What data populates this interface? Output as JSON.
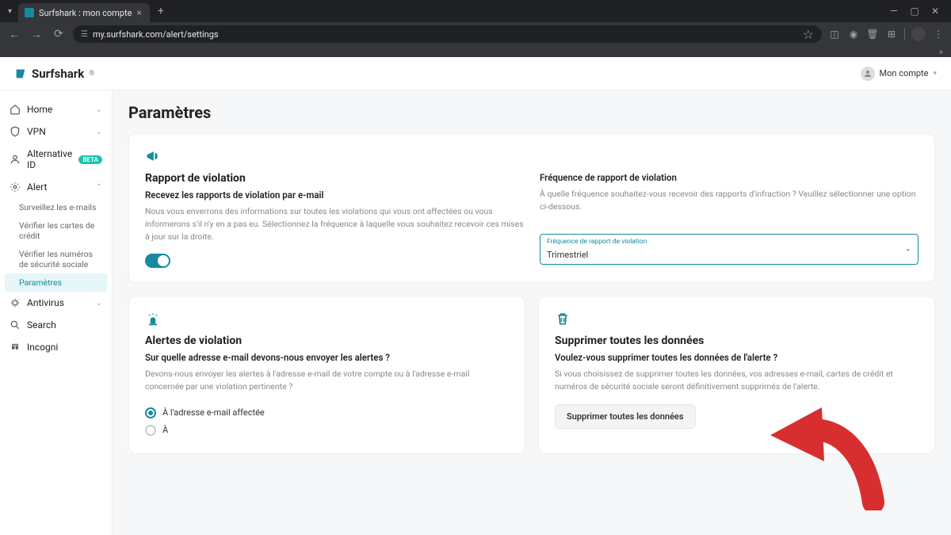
{
  "browser": {
    "tab_title": "Surfshark : mon compte",
    "url": "my.surfshark.com/alert/settings",
    "new_tab": "+",
    "close": "×",
    "star": "☆",
    "win_min": "—",
    "win_max": "▢",
    "win_close": "✕",
    "chevrons": "»"
  },
  "header": {
    "brand": "Surfshark",
    "account_label": "Mon compte"
  },
  "sidebar": {
    "items": [
      {
        "label": "Home",
        "expandable": true
      },
      {
        "label": "VPN",
        "expandable": true
      },
      {
        "label": "Alternative ID",
        "badge": "BETA"
      },
      {
        "label": "Alert",
        "expandable": true,
        "expanded": true
      },
      {
        "label": "Antivirus",
        "expandable": true
      },
      {
        "label": "Search"
      },
      {
        "label": "Incogni"
      }
    ],
    "alert_sub": [
      {
        "label": "Surveillez les e-mails"
      },
      {
        "label": "Vérifier les cartes de crédit"
      },
      {
        "label": "Vérifier les numéros de sécurité sociale"
      },
      {
        "label": "Paramètres",
        "active": true
      }
    ]
  },
  "page": {
    "title": "Paramètres"
  },
  "report": {
    "title": "Rapport de violation",
    "sub": "Recevez les rapports de violation par e-mail",
    "desc": "Nous vous enverrons des informations sur toutes les violations qui vous ont affectées ou vous informerons s'il n'y en a pas eu. Sélectionnez la fréquence à laquelle vous souhaitez recevoir ces mises à jour sur la droite.",
    "freq_title": "Fréquence de rapport de violation",
    "freq_desc": "À quelle fréquence souhaitez-vous recevoir des rapports d'infraction ? Veuillez sélectionner une option ci-dessous.",
    "select_label": "Fréquence de rapport de violation",
    "select_value": "Trimestriel"
  },
  "alerts": {
    "title": "Alertes de violation",
    "sub": "Sur quelle adresse e-mail devons-nous envoyer les alertes ?",
    "desc": "Devons-nous envoyer les alertes à l'adresse e-mail de votre compte ou à l'adresse e-mail concernée par une violation pertinente ?",
    "opt1": "À l'adresse e-mail affectée",
    "opt2": "À"
  },
  "delete": {
    "title": "Supprimer toutes les données",
    "sub": "Voulez-vous supprimer toutes les données de l'alerte ?",
    "desc": "Si vous choisissez de supprimer toutes les données, vos adresses e-mail, cartes de crédit et numéros de sécurité sociale seront définitivement supprimés de l'alerte.",
    "button": "Supprimer toutes les données"
  }
}
